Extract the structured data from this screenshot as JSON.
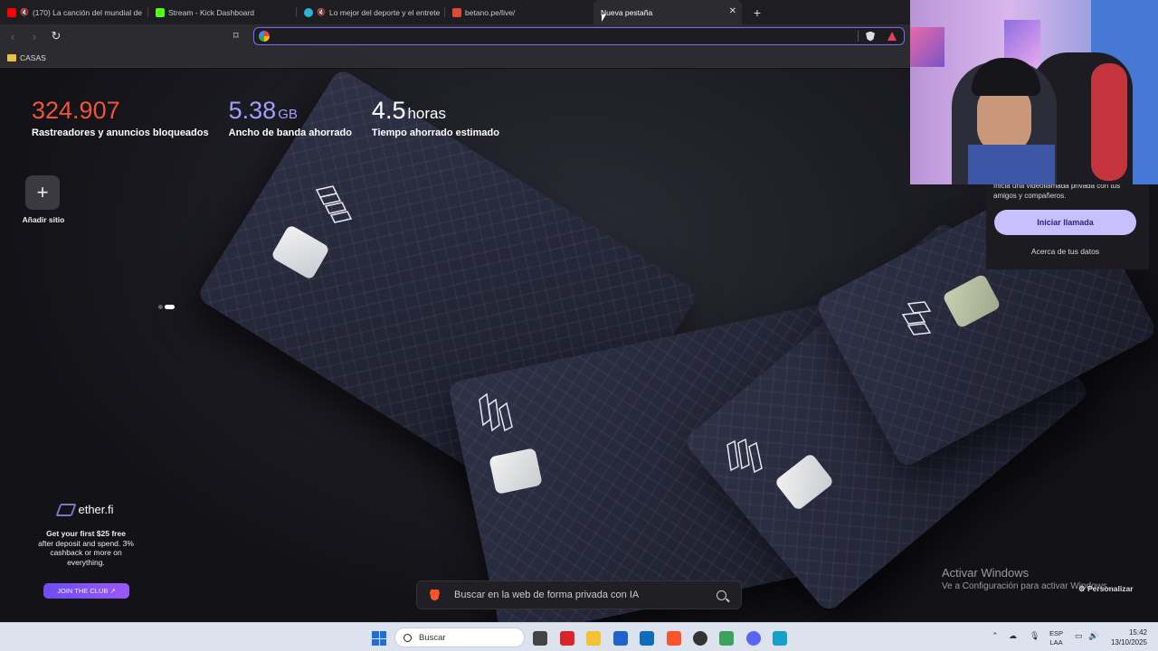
{
  "tabs": [
    {
      "title": "(170) La canción del mundial de",
      "favicon": "youtube-icon",
      "color": "#ff0000",
      "muted": true,
      "active": false
    },
    {
      "title": "Stream - Kick Dashboard",
      "favicon": "kick-icon",
      "color": "#53fc18",
      "muted": false,
      "active": false
    },
    {
      "title": "Lo mejor del deporte y el entrete",
      "favicon": "sports-icon",
      "color": "#27b7d8",
      "muted": true,
      "active": false
    },
    {
      "title": "betano.pe/live/",
      "favicon": "betano-icon",
      "color": "#e04a33",
      "muted": false,
      "active": false
    },
    {
      "title": "Nueva pestaña",
      "favicon": "",
      "color": "",
      "muted": false,
      "active": true
    }
  ],
  "address_bar": {
    "value": "",
    "placeholder": ""
  },
  "bookmarks": [
    {
      "label": "CASAS",
      "icon": "folder-icon"
    }
  ],
  "stats": [
    {
      "value": "324.907",
      "unit": "",
      "label": "Rastreadores y anuncios bloqueados",
      "color": "#f0543a"
    },
    {
      "value": "5.38",
      "unit": "GB",
      "label": "Ancho de banda ahorrado",
      "color": "#a69cff"
    },
    {
      "value": "4.5",
      "unit": "horas",
      "label": "Tiempo ahorrado estimado",
      "color": "#ffffff"
    }
  ],
  "add_site": {
    "label": "Añadir sitio"
  },
  "sponsor": {
    "brand": "ether.fi",
    "headline": "Get your first $25 free",
    "body": "after deposit and spend. 3% cashback or more on everything.",
    "cta": "JOIN THE CLUB ↗"
  },
  "search": {
    "placeholder": "Buscar en la web de forma privada con IA"
  },
  "call_panel": {
    "description": "Inicia una videollamada privada con tus amigos y compañeros.",
    "button": "Iniciar llamada",
    "about": "Acerca de tus datos"
  },
  "watermark": {
    "line1": "Activar Windows",
    "line2": "Ve a Configuración para activar Windows."
  },
  "customize": "Personalizar",
  "taskbar": {
    "search_label": "Buscar",
    "lang": "ESP",
    "lang2": "LAA",
    "time": "15:42",
    "date": "13/10/2025"
  }
}
